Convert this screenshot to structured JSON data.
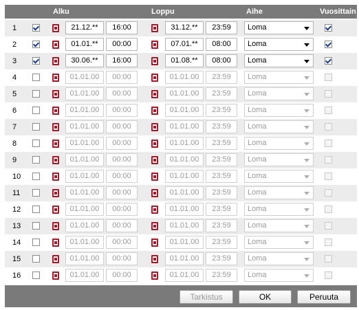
{
  "header": {
    "alku": "Alku",
    "loppu": "Loppu",
    "aihe": "Aihe",
    "vuosittain": "Vuosittain"
  },
  "rows": [
    {
      "num": "1",
      "enabled": true,
      "start_date": "21.12.**",
      "start_time": "16:00",
      "end_date": "31.12.**",
      "end_time": "23:59",
      "subject": "Loma",
      "yearly": true
    },
    {
      "num": "2",
      "enabled": true,
      "start_date": "01.01.**",
      "start_time": "00:00",
      "end_date": "07.01.**",
      "end_time": "08:00",
      "subject": "Loma",
      "yearly": true
    },
    {
      "num": "3",
      "enabled": true,
      "start_date": "30.06.**",
      "start_time": "16:00",
      "end_date": "01.08.**",
      "end_time": "08:00",
      "subject": "Loma",
      "yearly": true
    },
    {
      "num": "4",
      "enabled": false,
      "start_date": "01.01.00",
      "start_time": "00:00",
      "end_date": "01.01.00",
      "end_time": "23:59",
      "subject": "Loma",
      "yearly": false
    },
    {
      "num": "5",
      "enabled": false,
      "start_date": "01.01.00",
      "start_time": "00:00",
      "end_date": "01.01.00",
      "end_time": "23:59",
      "subject": "Loma",
      "yearly": false
    },
    {
      "num": "6",
      "enabled": false,
      "start_date": "01.01.00",
      "start_time": "00:00",
      "end_date": "01.01.00",
      "end_time": "23:59",
      "subject": "Loma",
      "yearly": false
    },
    {
      "num": "7",
      "enabled": false,
      "start_date": "01.01.00",
      "start_time": "00:00",
      "end_date": "01.01.00",
      "end_time": "23:59",
      "subject": "Loma",
      "yearly": false
    },
    {
      "num": "8",
      "enabled": false,
      "start_date": "01.01.00",
      "start_time": "00:00",
      "end_date": "01.01.00",
      "end_time": "23:59",
      "subject": "Loma",
      "yearly": false
    },
    {
      "num": "9",
      "enabled": false,
      "start_date": "01.01.00",
      "start_time": "00:00",
      "end_date": "01.01.00",
      "end_time": "23:59",
      "subject": "Loma",
      "yearly": false
    },
    {
      "num": "10",
      "enabled": false,
      "start_date": "01.01.00",
      "start_time": "00:00",
      "end_date": "01.01.00",
      "end_time": "23:59",
      "subject": "Loma",
      "yearly": false
    },
    {
      "num": "11",
      "enabled": false,
      "start_date": "01.01.00",
      "start_time": "00:00",
      "end_date": "01.01.00",
      "end_time": "23:59",
      "subject": "Loma",
      "yearly": false
    },
    {
      "num": "12",
      "enabled": false,
      "start_date": "01.01.00",
      "start_time": "00:00",
      "end_date": "01.01.00",
      "end_time": "23:59",
      "subject": "Loma",
      "yearly": false
    },
    {
      "num": "13",
      "enabled": false,
      "start_date": "01.01.00",
      "start_time": "00:00",
      "end_date": "01.01.00",
      "end_time": "23:59",
      "subject": "Loma",
      "yearly": false
    },
    {
      "num": "14",
      "enabled": false,
      "start_date": "01.01.00",
      "start_time": "00:00",
      "end_date": "01.01.00",
      "end_time": "23:59",
      "subject": "Loma",
      "yearly": false
    },
    {
      "num": "15",
      "enabled": false,
      "start_date": "01.01.00",
      "start_time": "00:00",
      "end_date": "01.01.00",
      "end_time": "23:59",
      "subject": "Loma",
      "yearly": false
    },
    {
      "num": "16",
      "enabled": false,
      "start_date": "01.01.00",
      "start_time": "00:00",
      "end_date": "01.01.00",
      "end_time": "23:59",
      "subject": "Loma",
      "yearly": false
    }
  ],
  "footer": {
    "check_label": "Tarkistus",
    "ok_label": "OK",
    "cancel_label": "Peruuta"
  },
  "colors": {
    "header_bg": "#7a7a7a",
    "row_alt_bg": "#ececec",
    "calendar_icon": "#a01a2a",
    "checkmark": "#1a3d8f"
  },
  "icons": {
    "calendar": "calendar-icon",
    "dropdown": "chevron-down-icon"
  }
}
